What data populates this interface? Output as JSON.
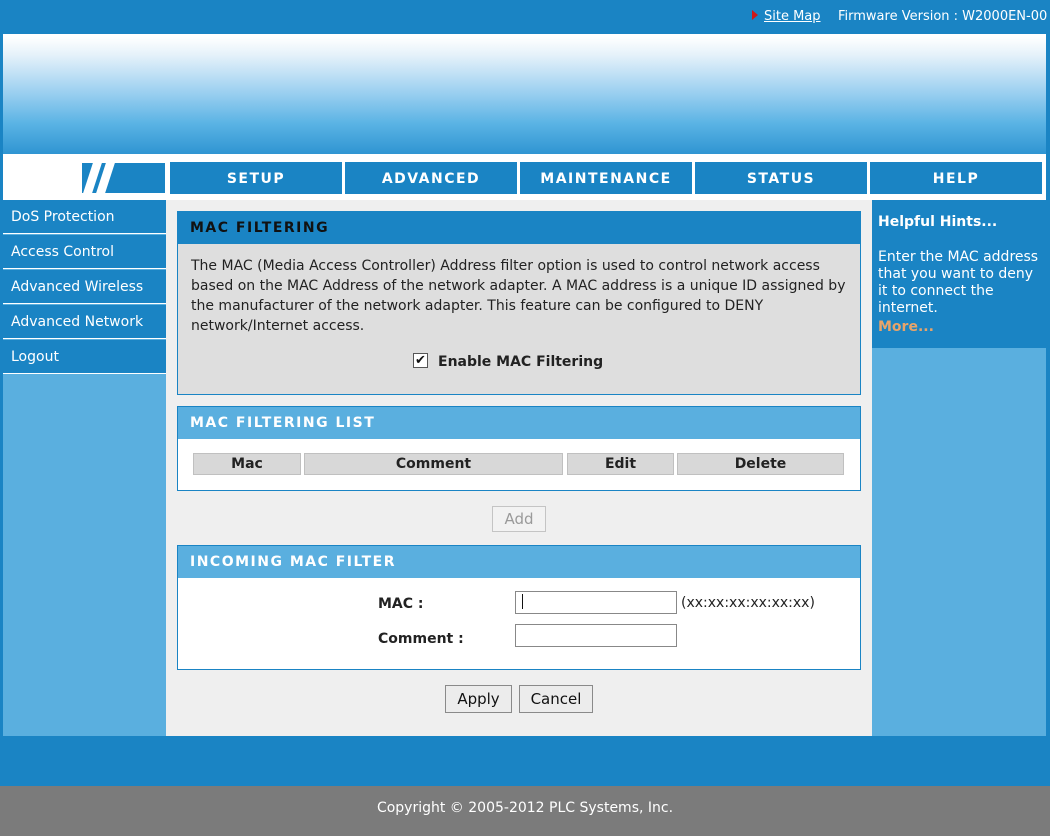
{
  "header": {
    "site_map": "Site Map",
    "firmware": "Firmware Version : W2000EN-00"
  },
  "nav": {
    "tabs": [
      "SETUP",
      "ADVANCED",
      "MAINTENANCE",
      "STATUS",
      "HELP"
    ]
  },
  "sidebar": {
    "items": [
      {
        "label": "DoS Protection"
      },
      {
        "label": "Access Control"
      },
      {
        "label": "Advanced Wireless"
      },
      {
        "label": "Advanced Network"
      },
      {
        "label": "Logout"
      }
    ]
  },
  "mac_filtering": {
    "title": "MAC FILTERING",
    "description": "The MAC (Media Access Controller) Address filter option is used to control network access based on the MAC Address of the network adapter. A MAC address is a unique ID assigned by the manufacturer of the network adapter. This feature can be configured to DENY network/Internet access.",
    "enable_label": "Enable MAC Filtering",
    "enabled": true,
    "checkmark": "✔"
  },
  "filter_list": {
    "title": "MAC FILTERING LIST",
    "columns": [
      "Mac",
      "Comment",
      "Edit",
      "Delete"
    ]
  },
  "add_button": "Add",
  "incoming": {
    "title": "INCOMING MAC FILTER",
    "mac_label": "MAC :",
    "mac_value": "",
    "mac_hint": "(xx:xx:xx:xx:xx:xx)",
    "comment_label": "Comment :",
    "comment_value": ""
  },
  "buttons": {
    "apply": "Apply",
    "cancel": "Cancel"
  },
  "hints": {
    "title": "Helpful Hints...",
    "text": "Enter the MAC address that you want to deny it to connect the internet.",
    "more": "More..."
  },
  "footer": {
    "copyright": "Copyright © 2005-2012 PLC Systems, Inc."
  },
  "colors": {
    "primary_blue": "#1a84c4",
    "light_blue": "#5aafdf",
    "footer_gray": "#7b7b7b",
    "more_link": "#e8a46a"
  }
}
